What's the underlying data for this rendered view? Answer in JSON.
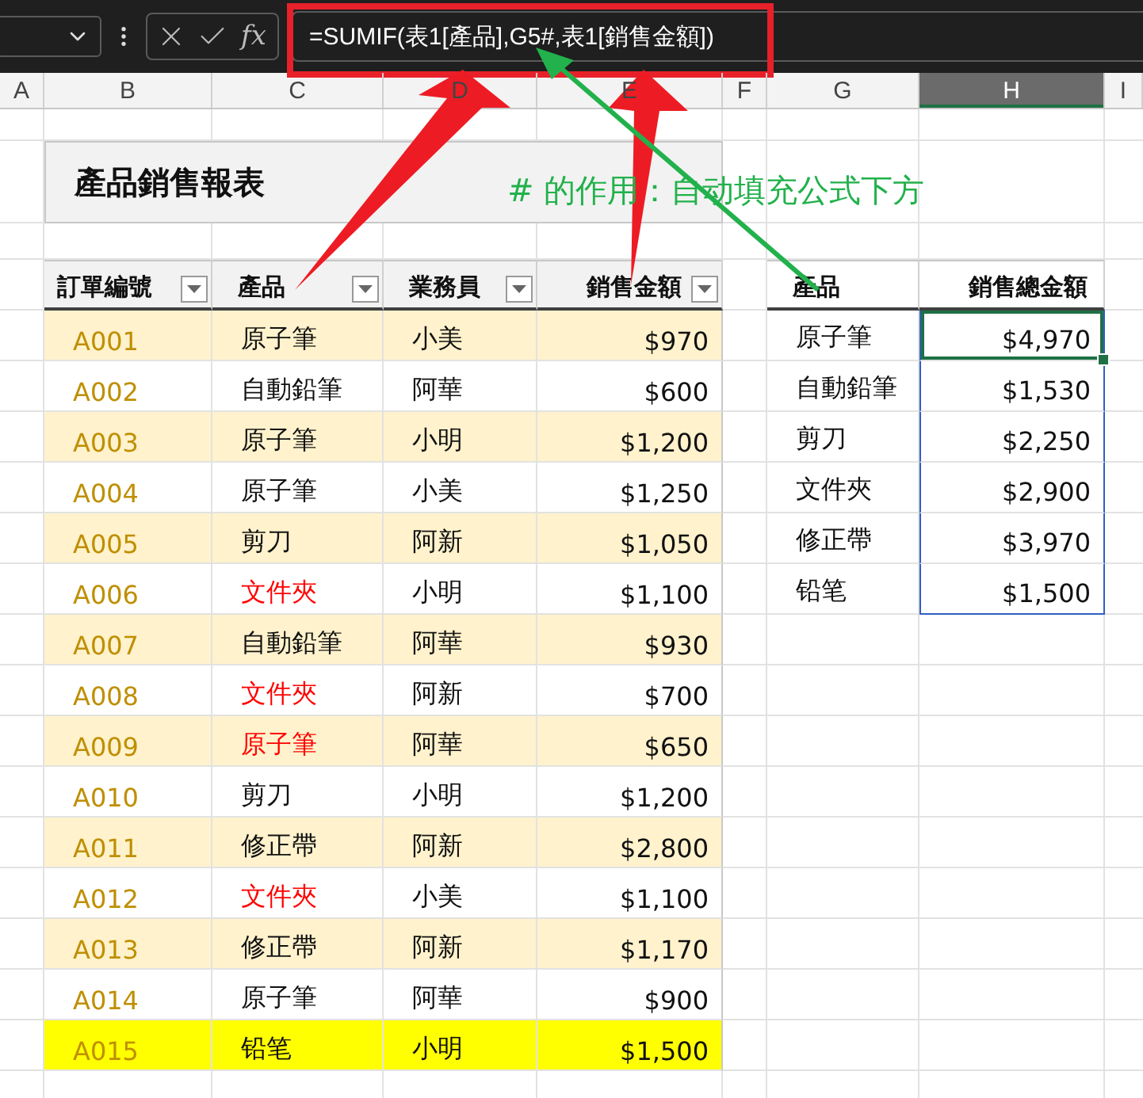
{
  "formula_bar": {
    "function_label": "fx",
    "formula": "=SUMIF(表1[產品],G5#,表1[銷售金額])"
  },
  "columns": [
    {
      "label": "A",
      "selected": false
    },
    {
      "label": "B",
      "selected": false
    },
    {
      "label": "C",
      "selected": false
    },
    {
      "label": "D",
      "selected": false
    },
    {
      "label": "E",
      "selected": false
    },
    {
      "label": "F",
      "selected": false
    },
    {
      "label": "G",
      "selected": false
    },
    {
      "label": "H",
      "selected": true
    },
    {
      "label": "I",
      "selected": false
    }
  ],
  "title": "產品銷售報表",
  "annotation": "# 的作用：自动填充公式下方",
  "table": {
    "columns": [
      "訂單編號",
      "產品",
      "業務員",
      "銷售金額"
    ],
    "rows": [
      {
        "order": "A001",
        "product": "原子筆",
        "rep": "小美",
        "amount": "$970",
        "flagged": false,
        "highlighted": false
      },
      {
        "order": "A002",
        "product": "自動鉛筆",
        "rep": "阿華",
        "amount": "$600",
        "flagged": false,
        "highlighted": false
      },
      {
        "order": "A003",
        "product": "原子筆",
        "rep": "小明",
        "amount": "$1,200",
        "flagged": false,
        "highlighted": false
      },
      {
        "order": "A004",
        "product": "原子筆",
        "rep": "小美",
        "amount": "$1,250",
        "flagged": false,
        "highlighted": false
      },
      {
        "order": "A005",
        "product": "剪刀",
        "rep": "阿新",
        "amount": "$1,050",
        "flagged": false,
        "highlighted": false
      },
      {
        "order": "A006",
        "product": "文件夾",
        "rep": "小明",
        "amount": "$1,100",
        "flagged": true,
        "highlighted": false
      },
      {
        "order": "A007",
        "product": "自動鉛筆",
        "rep": "阿華",
        "amount": "$930",
        "flagged": false,
        "highlighted": false
      },
      {
        "order": "A008",
        "product": "文件夾",
        "rep": "阿新",
        "amount": "$700",
        "flagged": true,
        "highlighted": false
      },
      {
        "order": "A009",
        "product": "原子筆",
        "rep": "阿華",
        "amount": "$650",
        "flagged": true,
        "highlighted": false
      },
      {
        "order": "A010",
        "product": "剪刀",
        "rep": "小明",
        "amount": "$1,200",
        "flagged": false,
        "highlighted": false
      },
      {
        "order": "A011",
        "product": "修正帶",
        "rep": "阿新",
        "amount": "$2,800",
        "flagged": false,
        "highlighted": false
      },
      {
        "order": "A012",
        "product": "文件夾",
        "rep": "小美",
        "amount": "$1,100",
        "flagged": true,
        "highlighted": false
      },
      {
        "order": "A013",
        "product": "修正帶",
        "rep": "阿新",
        "amount": "$1,170",
        "flagged": false,
        "highlighted": false
      },
      {
        "order": "A014",
        "product": "原子筆",
        "rep": "阿華",
        "amount": "$900",
        "flagged": false,
        "highlighted": false
      },
      {
        "order": "A015",
        "product": "铅笔",
        "rep": "小明",
        "amount": "$1,500",
        "flagged": false,
        "highlighted": true
      }
    ]
  },
  "summary": {
    "columns": [
      "產品",
      "銷售總金額"
    ],
    "rows": [
      {
        "product": "原子筆",
        "total": "$4,970",
        "selected": true
      },
      {
        "product": "自動鉛筆",
        "total": "$1,530",
        "selected": false
      },
      {
        "product": "剪刀",
        "total": "$2,250",
        "selected": false
      },
      {
        "product": "文件夾",
        "total": "$2,900",
        "selected": false
      },
      {
        "product": "修正帶",
        "total": "$3,970",
        "selected": false
      },
      {
        "product": "铅笔",
        "total": "$1,500",
        "selected": false
      }
    ]
  }
}
